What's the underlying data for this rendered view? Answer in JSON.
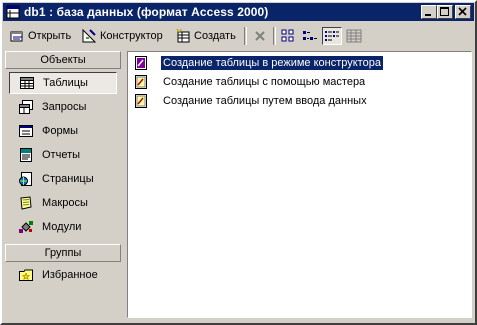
{
  "window": {
    "title": "db1 : база данных (формат Access 2000)"
  },
  "toolbar": {
    "open_label": "Открыть",
    "design_label": "Конструктор",
    "create_label": "Создать"
  },
  "objects_panel": {
    "header": "Объекты",
    "items": [
      {
        "label": "Таблицы",
        "icon": "table-icon"
      },
      {
        "label": "Запросы",
        "icon": "query-icon"
      },
      {
        "label": "Формы",
        "icon": "form-icon"
      },
      {
        "label": "Отчеты",
        "icon": "report-icon"
      },
      {
        "label": "Страницы",
        "icon": "page-icon"
      },
      {
        "label": "Макросы",
        "icon": "macro-icon"
      },
      {
        "label": "Модули",
        "icon": "module-icon"
      }
    ],
    "groups_header": "Группы",
    "favorites_label": "Избранное"
  },
  "list": {
    "items": [
      "Создание таблицы в режиме конструктора",
      "Создание таблицы с помощью мастера",
      "Создание таблицы путем ввода данных"
    ]
  },
  "colors": {
    "titlebar": "#0a246a",
    "face": "#d4d0c8",
    "selection": "#0a246a"
  }
}
